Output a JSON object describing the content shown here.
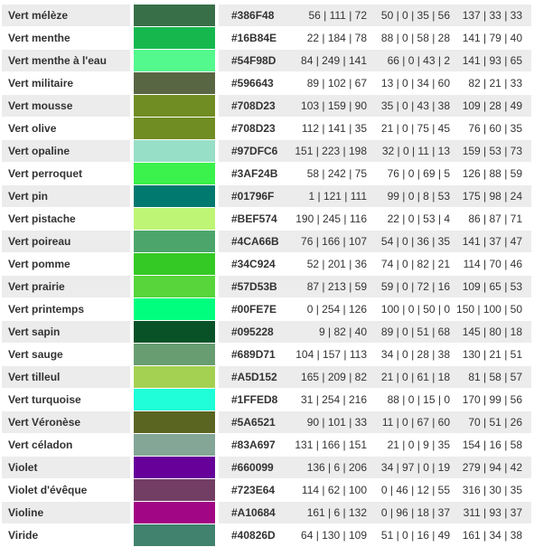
{
  "colors": [
    {
      "name": "Vert mélèze",
      "hex": "#386F48",
      "rgb": "56 | 111 | 72",
      "cmyk": "50 | 0 | 35 | 56",
      "hsl": "137 | 33 | 33"
    },
    {
      "name": "Vert menthe",
      "hex": "#16B84E",
      "rgb": "22 | 184 | 78",
      "cmyk": "88 | 0 | 58 | 28",
      "hsl": "141 | 79 | 40"
    },
    {
      "name": "Vert menthe à l'eau",
      "hex": "#54F98D",
      "rgb": "84 | 249 | 141",
      "cmyk": "66 | 0 | 43 | 2",
      "hsl": "141 | 93 | 65"
    },
    {
      "name": "Vert militaire",
      "hex": "#596643",
      "rgb": "89 | 102 | 67",
      "cmyk": "13 | 0 | 34 | 60",
      "hsl": "82 | 21 | 33"
    },
    {
      "name": "Vert mousse",
      "hex": "#708D23",
      "rgb": "103 | 159 | 90",
      "cmyk": "35 | 0 | 43 | 38",
      "hsl": "109 | 28 | 49"
    },
    {
      "name": "Vert olive",
      "hex": "#708D23",
      "rgb": "112 | 141 | 35",
      "cmyk": "21 | 0 | 75 | 45",
      "hsl": "76 | 60 | 35"
    },
    {
      "name": "Vert opaline",
      "hex": "#97DFC6",
      "rgb": "151 | 223 | 198",
      "cmyk": "32 | 0 | 11 | 13",
      "hsl": "159 | 53 | 73"
    },
    {
      "name": "Vert perroquet",
      "hex": "#3AF24B",
      "rgb": "58 | 242 | 75",
      "cmyk": "76 | 0 | 69 | 5",
      "hsl": "126 | 88 | 59"
    },
    {
      "name": "Vert pin",
      "hex": "#01796F",
      "rgb": "1 | 121 | 111",
      "cmyk": "99 | 0 | 8 | 53",
      "hsl": "175 | 98 | 24"
    },
    {
      "name": "Vert pistache",
      "hex": "#BEF574",
      "rgb": "190 | 245 | 116",
      "cmyk": "22 | 0 | 53 | 4",
      "hsl": "86 | 87 | 71"
    },
    {
      "name": "Vert poireau",
      "hex": "#4CA66B",
      "rgb": "76 | 166 | 107",
      "cmyk": "54 | 0 | 36 | 35",
      "hsl": "141 | 37 | 47"
    },
    {
      "name": "Vert pomme",
      "hex": "#34C924",
      "rgb": "52 | 201 | 36",
      "cmyk": "74 | 0 | 82 | 21",
      "hsl": "114 | 70 | 46"
    },
    {
      "name": "Vert prairie",
      "hex": "#57D53B",
      "rgb": "87 | 213 | 59",
      "cmyk": "59 | 0 | 72 | 16",
      "hsl": "109 | 65 | 53"
    },
    {
      "name": "Vert printemps",
      "hex": "#00FE7E",
      "rgb": "0 | 254 | 126",
      "cmyk": "100 | 0 | 50 | 0",
      "hsl": "150 | 100 | 50"
    },
    {
      "name": "Vert sapin",
      "hex": "#095228",
      "rgb": "9 | 82 | 40",
      "cmyk": "89 | 0 | 51 | 68",
      "hsl": "145 | 80 | 18"
    },
    {
      "name": "Vert sauge",
      "hex": "#689D71",
      "rgb": "104 | 157 | 113",
      "cmyk": "34 | 0 | 28 | 38",
      "hsl": "130 | 21 | 51"
    },
    {
      "name": "Vert tilleul",
      "hex": "#A5D152",
      "rgb": "165 | 209 | 82",
      "cmyk": "21 | 0 | 61 | 18",
      "hsl": "81 | 58 | 57"
    },
    {
      "name": "Vert turquoise",
      "hex": "#1FFED8",
      "rgb": "31 | 254 | 216",
      "cmyk": "88 | 0 | 15 | 0",
      "hsl": "170 | 99 | 56"
    },
    {
      "name": "Vert Véronèse",
      "hex": "#5A6521",
      "rgb": "90 | 101 | 33",
      "cmyk": "11 | 0 | 67 | 60",
      "hsl": "70 | 51 | 26"
    },
    {
      "name": "Vert céladon",
      "hex": "#83A697",
      "rgb": "131 | 166 | 151",
      "cmyk": "21 | 0 | 9 | 35",
      "hsl": "154 | 16 | 58"
    },
    {
      "name": "Violet",
      "hex": "#660099",
      "rgb": "136 | 6 | 206",
      "cmyk": "34 | 97 | 0 | 19",
      "hsl": "279 | 94 | 42"
    },
    {
      "name": "Violet d'évêque",
      "hex": "#723E64",
      "rgb": "114 | 62 | 100",
      "cmyk": "0 | 46 | 12 | 55",
      "hsl": "316 | 30 | 35"
    },
    {
      "name": "Violine",
      "hex": "#A10684",
      "rgb": "161 | 6 | 132",
      "cmyk": "0 | 96 | 18 | 37",
      "hsl": "311 | 93 | 37"
    },
    {
      "name": "Viride",
      "hex": "#40826D",
      "rgb": "64 | 130 | 109",
      "cmyk": "51 | 0 | 16 | 49",
      "hsl": "161 | 34 | 38"
    }
  ],
  "swatch_colors": [
    "#386F48",
    "#16B84E",
    "#54F98D",
    "#596643",
    "#708D23",
    "#708D23",
    "#97DFC6",
    "#3AF24B",
    "#01796F",
    "#BEF574",
    "#4CA66B",
    "#34C924",
    "#57D53B",
    "#00FE7E",
    "#095228",
    "#689D71",
    "#A5D152",
    "#1FFED8",
    "#5A6521",
    "#83A697",
    "#660099",
    "#723E64",
    "#A10684",
    "#40826D"
  ],
  "style": {
    "row_stripe": "#ECECEC",
    "row_plain": "#FFFFFF",
    "text": "#333333"
  }
}
